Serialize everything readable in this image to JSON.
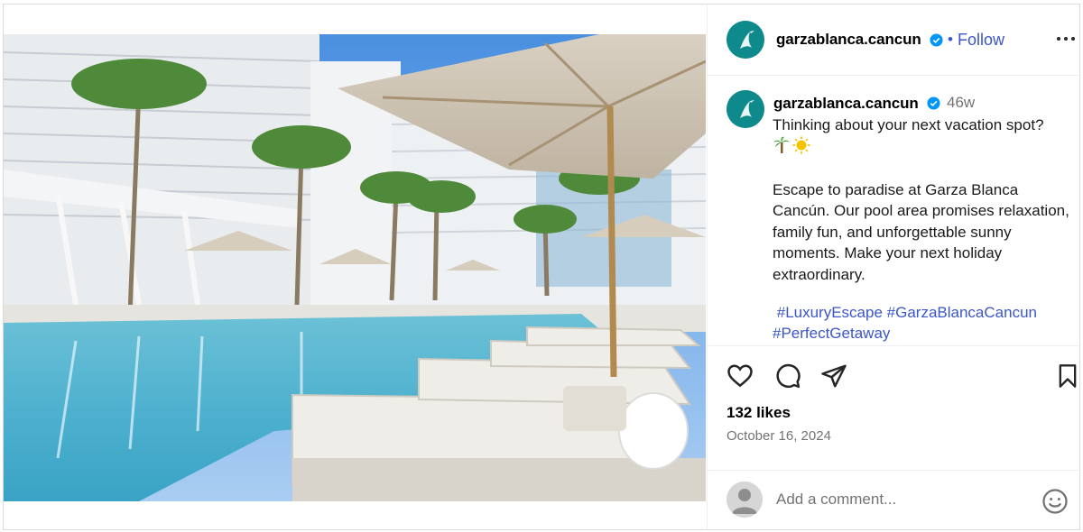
{
  "post": {
    "account": "garzablanca.cancun",
    "follow_label": "Follow",
    "separator": "•",
    "age": "46w",
    "caption_line1": "Thinking about your next vacation spot?",
    "caption_emojis": [
      "palm-tree",
      "sun"
    ],
    "caption_body": "Escape to paradise at Garza Blanca Cancún. Our pool area promises relaxation, family fun, and unforgettable sunny moments. Make your next holiday extraordinary.",
    "hashtags": [
      "#LuxuryEscape",
      "#GarzaBlancaCancun",
      "#PerfectGetaway"
    ],
    "likes": "132 likes",
    "date": "October 16, 2024",
    "comment_placeholder": "Add a comment..."
  },
  "icons": {
    "verified": "verified-badge-icon",
    "more": "more-options-icon",
    "like": "heart-icon",
    "comment": "comment-icon",
    "share": "share-icon",
    "save": "bookmark-icon",
    "emoji": "emoji-icon"
  },
  "colors": {
    "link_blue": "#3b56c9",
    "verified_blue": "#0095f6",
    "brand_teal": "#0f8a8c",
    "muted": "#737373"
  }
}
